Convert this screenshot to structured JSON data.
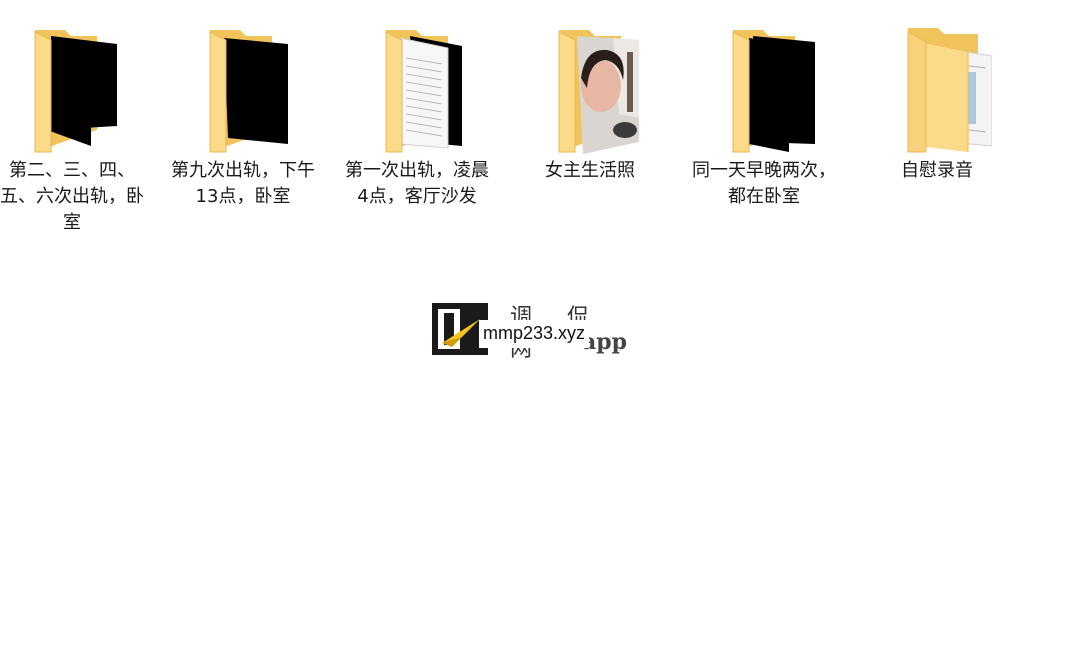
{
  "folders": [
    {
      "label": "第二、三、四、五、六次出轨，卧室",
      "icon": "folder-dark-icon"
    },
    {
      "label": "第九次出轨，下午13点，卧室",
      "icon": "folder-dark-icon"
    },
    {
      "label": "第一次出轨，凌晨4点，客厅沙发",
      "icon": "folder-document-icon"
    },
    {
      "label": "女主生活照",
      "icon": "folder-photo-icon"
    },
    {
      "label": "同一天早晚两次，都在卧室",
      "icon": "folder-dark-icon"
    },
    {
      "label": "自慰录音",
      "icon": "folder-document-icon"
    }
  ],
  "watermark": {
    "logo_text": "P",
    "chinese_text": "调 侃 网",
    "english_text": "app",
    "url_text": "mmp233.xyz"
  },
  "colors": {
    "folder_back": "#f0c35b",
    "folder_front": "#fbdb8a",
    "dark_content": "#000000",
    "background": "#ffffff"
  }
}
